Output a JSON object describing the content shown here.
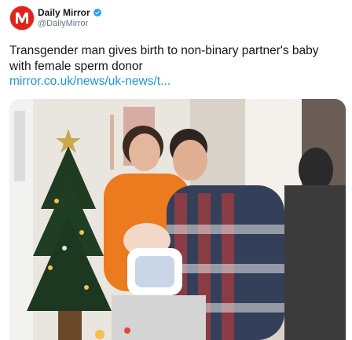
{
  "account": {
    "name": "Daily Mirror",
    "handle": "@DailyMirror",
    "verified": true,
    "avatar_icon": "mirror-logo-icon",
    "brand_color": "#e2231a"
  },
  "tweet": {
    "text": "Transgender man gives birth to non-binary partner's baby with female sperm donor",
    "link_text": "mirror.co.uk/news/uk-news/t...",
    "link_color": "#1b95e0"
  },
  "media": {
    "description_icon": "photo-family-christmas"
  }
}
